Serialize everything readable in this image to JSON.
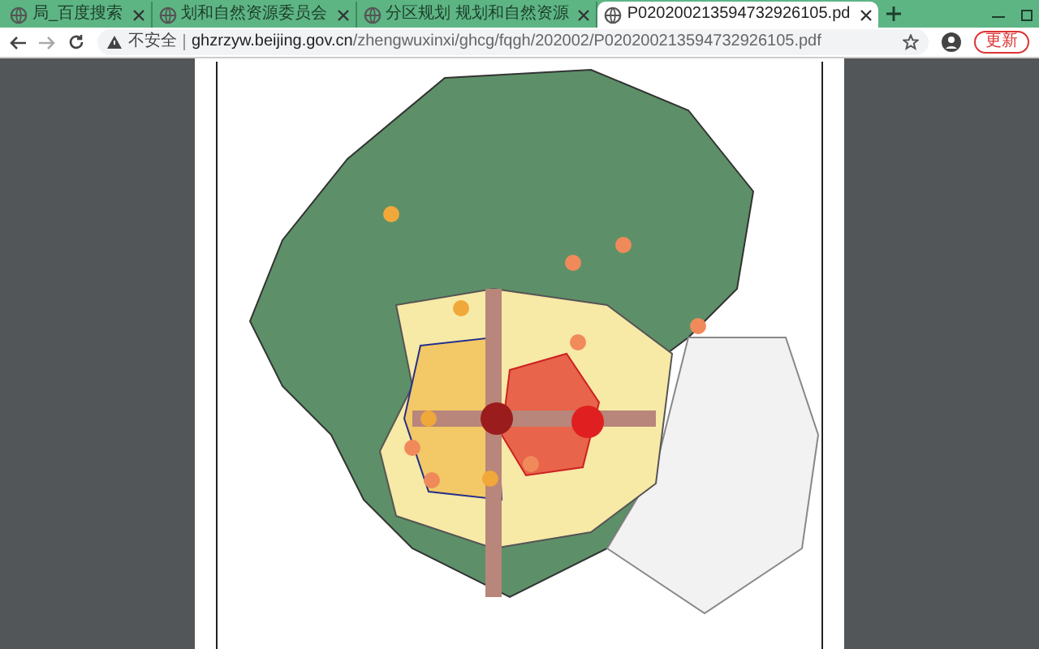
{
  "tabs": [
    {
      "kind": "page",
      "title": "局_百度搜索",
      "selected": false
    },
    {
      "kind": "page",
      "title": "划和自然资源委员会",
      "selected": false
    },
    {
      "kind": "page",
      "title": "分区规划 规划和自然资源",
      "selected": false
    },
    {
      "kind": "page",
      "title": "P020200213594732926105.pd",
      "selected": true
    }
  ],
  "toolbar": {
    "security": "不安全",
    "host": "ghzrzyw.beijing.gov.cn",
    "path": "/zhengwuxinxi/ghcg/fqgh/202002/P020200213594732926105.pdf",
    "update": "更新"
  }
}
